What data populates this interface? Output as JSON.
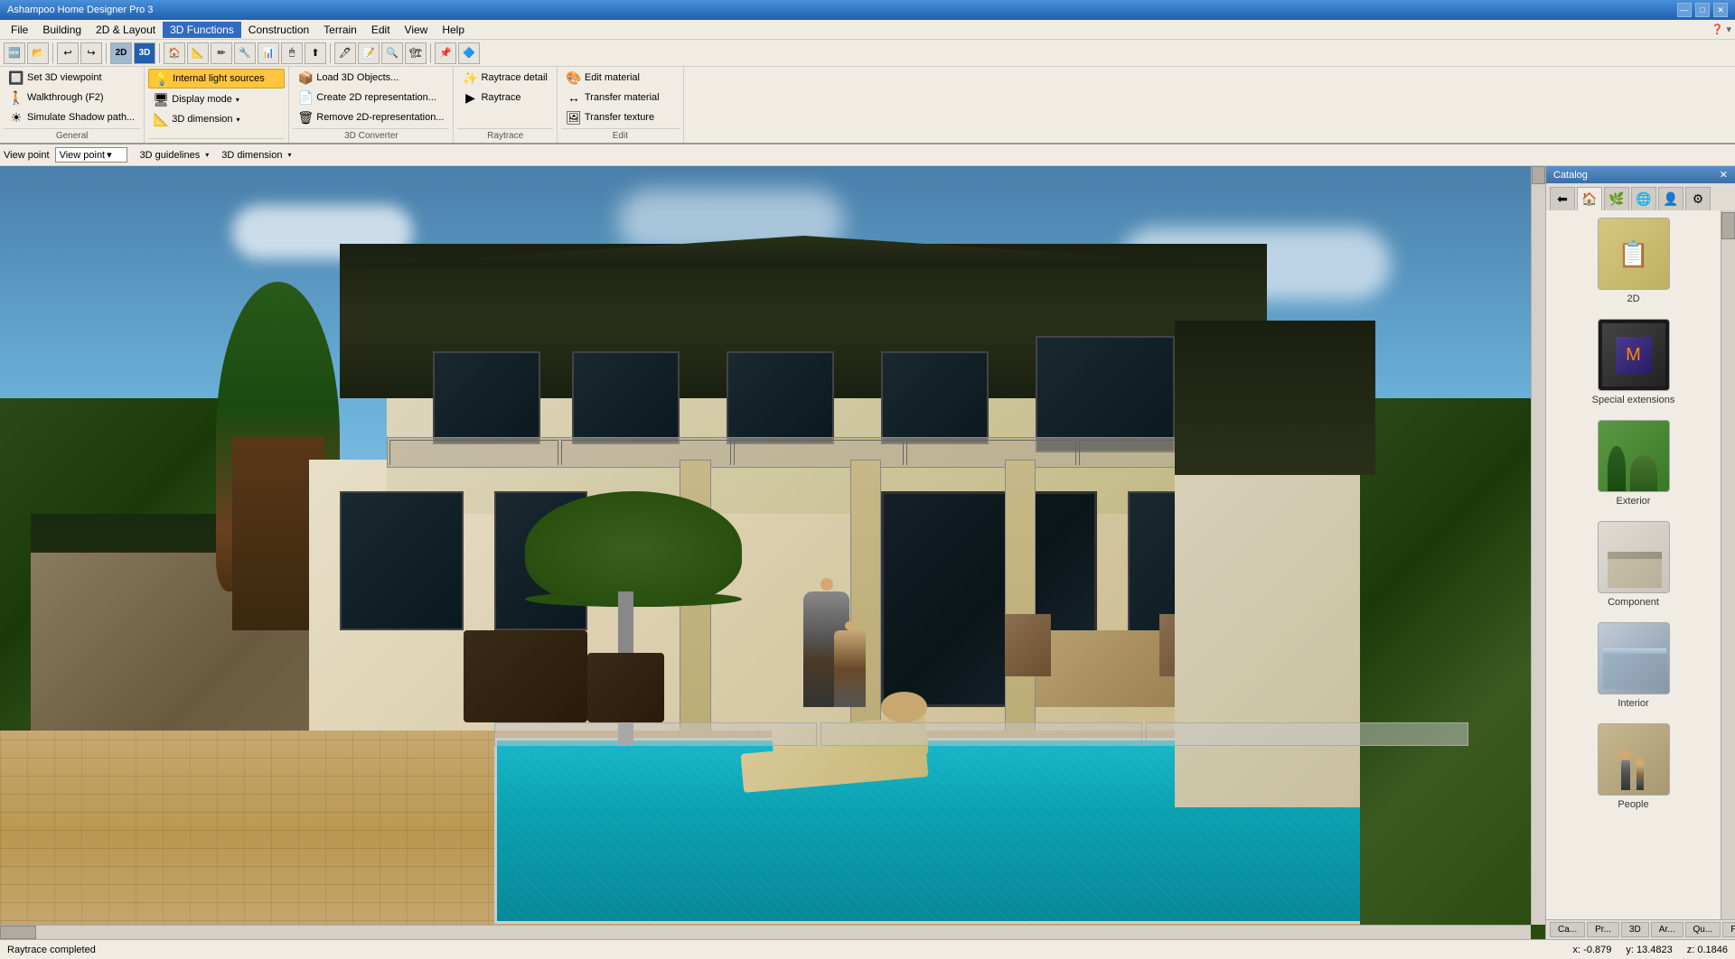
{
  "titleBar": {
    "title": "Ashampoo Home Designer Pro 3",
    "controls": [
      "—",
      "□",
      "✕"
    ]
  },
  "menuBar": {
    "items": [
      "File",
      "Building",
      "2D & Layout",
      "3D Functions",
      "Construction",
      "Terrain",
      "Edit",
      "View",
      "Help"
    ]
  },
  "ribbon": {
    "activeTab": "3D Functions",
    "groups": {
      "general": {
        "label": "General",
        "items": [
          {
            "id": "set3d",
            "icon": "🔲",
            "label": "Set 3D viewpoint"
          },
          {
            "id": "walkthrough",
            "icon": "🚶",
            "label": "Walkthrough (F2)"
          },
          {
            "id": "simulate",
            "icon": "☀",
            "label": "Simulate Shadow path..."
          }
        ],
        "viewPoint": {
          "label": "View point",
          "dropdown": "View point"
        },
        "items2": [
          {
            "id": "viewpoint",
            "icon": "👁",
            "label": "View point"
          },
          {
            "id": "guidelines",
            "icon": "📏",
            "label": "3D guidelines"
          }
        ]
      },
      "internalLightSources": {
        "label": "",
        "activeItem": "Internal light sources",
        "items": [
          {
            "id": "internal-light",
            "icon": "💡",
            "label": "Internal light sources",
            "active": true
          },
          {
            "id": "display-mode",
            "icon": "🖥",
            "label": "Display mode"
          },
          {
            "id": "3d-dimension",
            "icon": "📐",
            "label": "3D dimension"
          }
        ]
      },
      "converter3d": {
        "label": "3D Converter",
        "items": [
          {
            "id": "load3d",
            "icon": "📦",
            "label": "Load 3D Objects..."
          },
          {
            "id": "create2d",
            "icon": "📄",
            "label": "Create 2D representation..."
          },
          {
            "id": "remove2d",
            "icon": "🗑",
            "label": "Remove 2D-representation..."
          }
        ]
      },
      "raytrace": {
        "label": "Raytrace",
        "items": [
          {
            "id": "raytrace-detail",
            "icon": "✨",
            "label": "Raytrace detail"
          },
          {
            "id": "raytrace",
            "icon": "▶",
            "label": "Raytrace"
          }
        ]
      },
      "edit": {
        "label": "Edit",
        "items": [
          {
            "id": "edit-material",
            "icon": "🎨",
            "label": "Edit material"
          },
          {
            "id": "transfer-material",
            "icon": "↔",
            "label": "Transfer material"
          },
          {
            "id": "transfer-texture",
            "icon": "🖼",
            "label": "Transfer texture"
          }
        ]
      }
    }
  },
  "viewpointBar": {
    "viewPointLabel": "View point",
    "viewPointValue": "",
    "guidelinesLabel": "3D guidelines",
    "dimensionLabel": "3D dimension"
  },
  "viewport": {
    "status": "Raytrace completed"
  },
  "catalog": {
    "title": "Catalog",
    "tabs": [
      "⬅",
      "🏠",
      "🌿",
      "🔧",
      "🌐",
      "⚙"
    ],
    "items": [
      {
        "id": "2d",
        "label": "2D",
        "icon": "📋",
        "color": "#d4b870"
      },
      {
        "id": "special-extensions",
        "label": "Special extensions",
        "icon": "🎮",
        "color": "#222222"
      },
      {
        "id": "exterior",
        "label": "Exterior",
        "icon": "🌳",
        "color": "#4a8a30"
      },
      {
        "id": "component",
        "label": "Component",
        "icon": "🪑",
        "color": "#d0ccc4"
      },
      {
        "id": "interior",
        "label": "Interior",
        "icon": "🛋",
        "color": "#a0b4c8"
      },
      {
        "id": "people",
        "label": "People",
        "icon": "👤",
        "color": "#c8a870"
      }
    ]
  },
  "statusBar": {
    "status": "Raytrace completed",
    "coords": {
      "x": "x: -0.879",
      "y": "y: 13.4823",
      "z": "z: 0.1846"
    }
  },
  "bottomTabs": [
    {
      "id": "catalog",
      "label": "Ca...",
      "active": false
    },
    {
      "id": "properties",
      "label": "Pr...",
      "active": false
    },
    {
      "id": "3d",
      "label": "3D",
      "active": false
    },
    {
      "id": "ar",
      "label": "Ar...",
      "active": false
    },
    {
      "id": "qu",
      "label": "Qu...",
      "active": false
    },
    {
      "id": "pv",
      "label": "PV...",
      "active": false
    }
  ]
}
